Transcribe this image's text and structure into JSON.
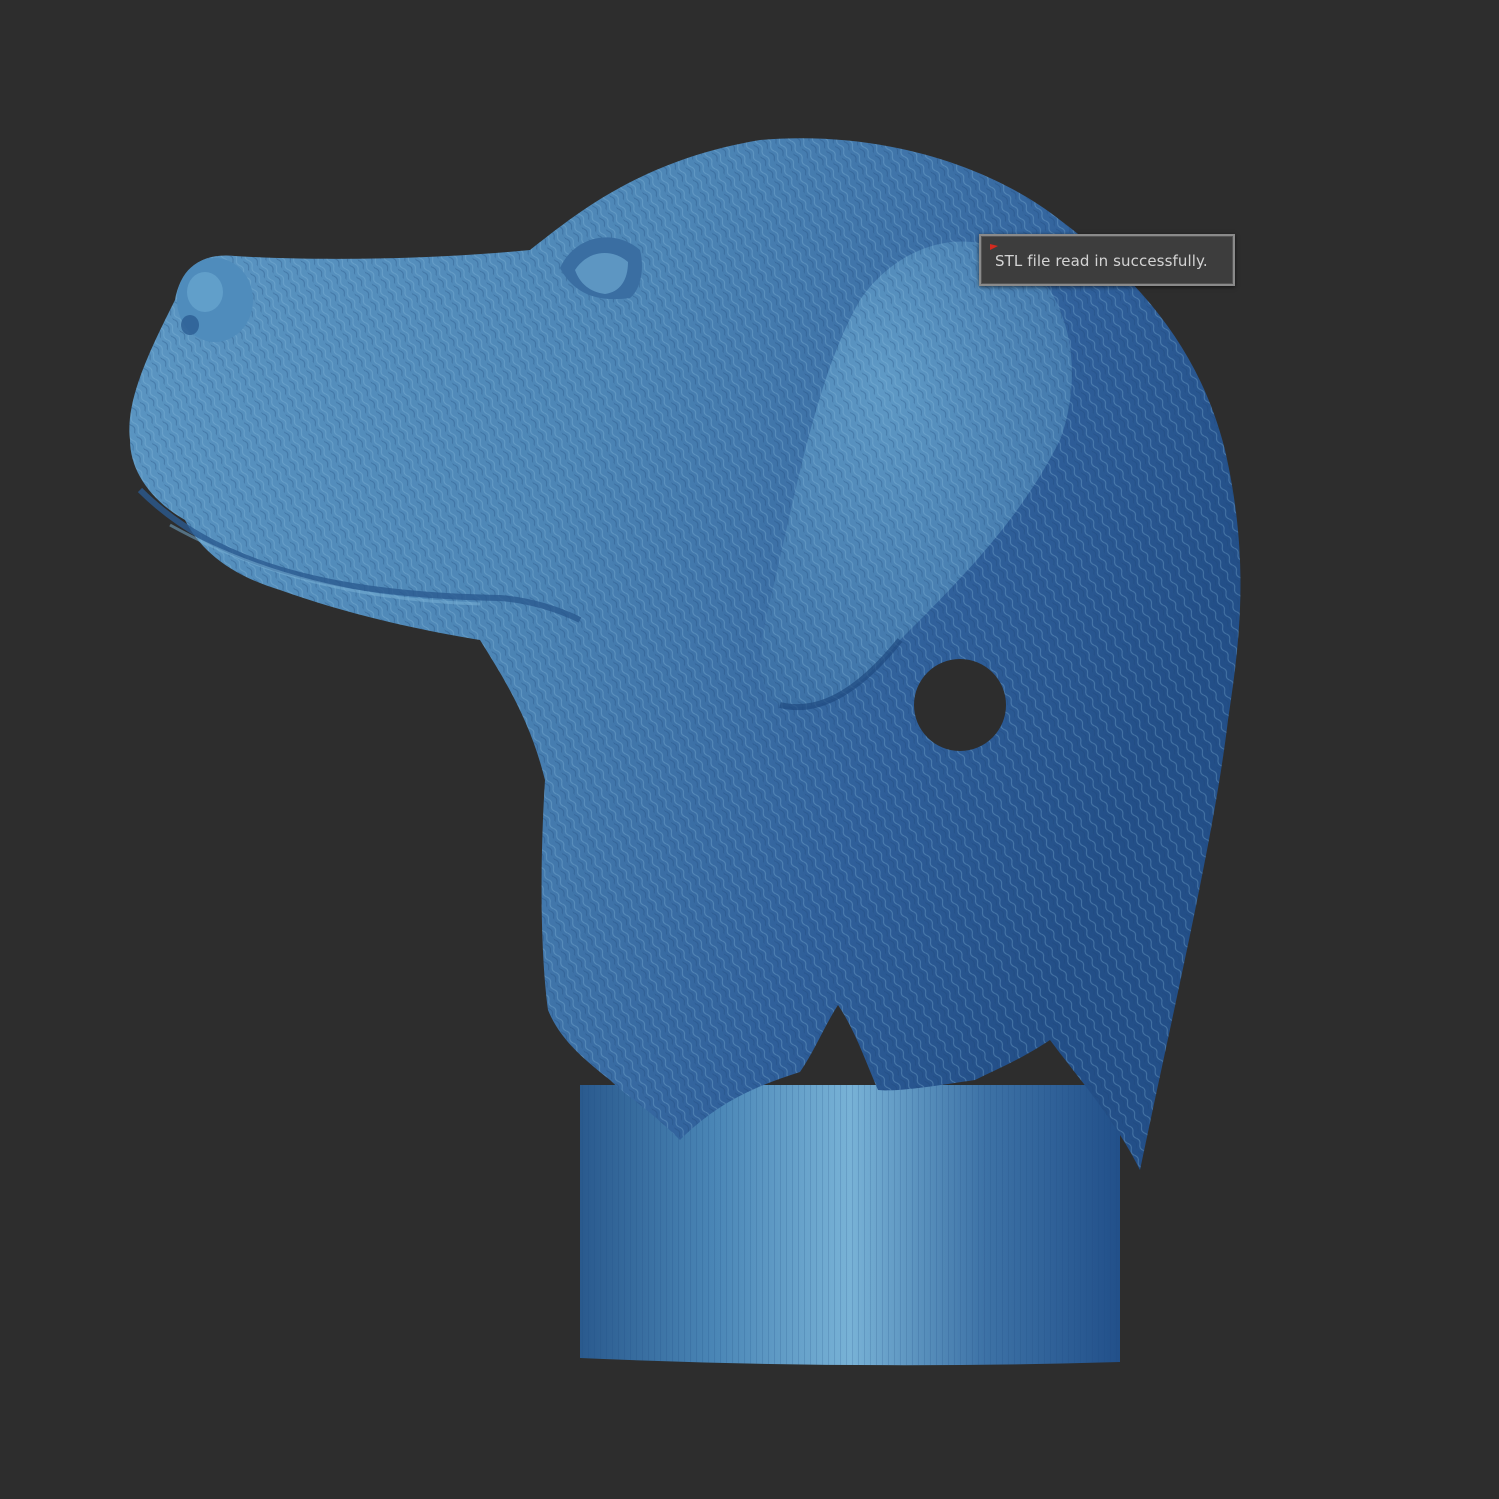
{
  "viewport": {
    "background_color": "#2d2d2d",
    "model_color": "#3f6f9f",
    "model_highlight": "#6ea6cf",
    "model_shadow": "#23507e"
  },
  "notification": {
    "message": "STL file read in successfully.",
    "flag_icon": "red-flag-icon",
    "flag_color": "#d42a1e"
  }
}
